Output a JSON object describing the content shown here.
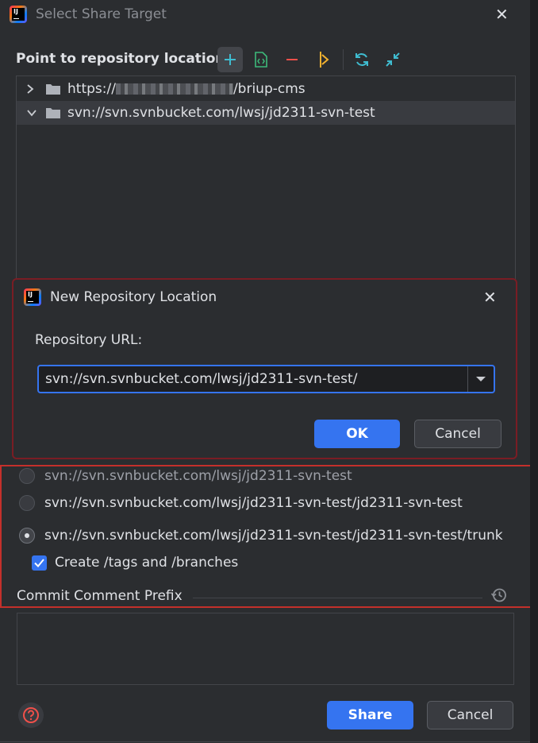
{
  "window": {
    "title": "Select Share Target"
  },
  "toolbar": {
    "label": "Point to repository location"
  },
  "tree": {
    "items": [
      {
        "prefix": "https://",
        "suffix": "/briup-cms",
        "expanded": false
      },
      {
        "url": "svn://svn.svnbucket.com/lwsj/jd2311-svn-test",
        "expanded": true
      }
    ]
  },
  "modal": {
    "title": "New Repository Location",
    "repo_label": "Repository URL:",
    "repo_url": "svn://svn.svnbucket.com/lwsj/jd2311-svn-test/",
    "ok_label": "OK",
    "cancel_label": "Cancel"
  },
  "options": {
    "radio1": "svn://svn.svnbucket.com/lwsj/jd2311-svn-test",
    "radio2": "svn://svn.svnbucket.com/lwsj/jd2311-svn-test/jd2311-svn-test",
    "radio3": "svn://svn.svnbucket.com/lwsj/jd2311-svn-test/jd2311-svn-test/trunk",
    "checkbox_label": "Create /tags and /branches"
  },
  "commit": {
    "prefix_label": "Commit Comment Prefix",
    "comment_value": ""
  },
  "footer": {
    "share_label": "Share",
    "cancel_label": "Cancel"
  },
  "colors": {
    "accent": "#3574f0",
    "highlight_border": "#c4302b",
    "modal_border": "#7a1d24"
  }
}
